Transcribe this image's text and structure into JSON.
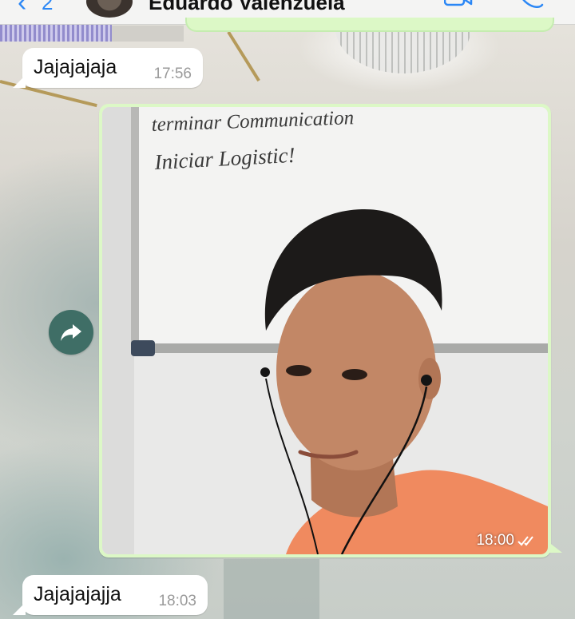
{
  "header": {
    "back_icon": "chevron-left-icon",
    "unread_count": "2",
    "contact_name": "Eduardo Valenzuela",
    "video_call_icon": "video-camera-icon",
    "voice_call_icon": "phone-icon"
  },
  "messages": [
    {
      "direction": "incoming",
      "type": "text",
      "text": "Jajajajaja",
      "time": "17:56"
    },
    {
      "direction": "outgoing",
      "type": "image",
      "time": "18:00",
      "status_icon": "double-check-icon",
      "image_text_line1": "terminar Communication",
      "image_text_line2": "Iniciar Logistic!"
    },
    {
      "direction": "incoming",
      "type": "text",
      "text": "Jajajajajja",
      "time": "18:03"
    }
  ],
  "actions": {
    "forward_icon": "forward-arrow-icon"
  },
  "colors": {
    "accent": "#2b87f5",
    "outgoing_bubble": "#dcf8c6",
    "incoming_bubble": "#ffffff",
    "forward_button": "#3f6e66"
  }
}
